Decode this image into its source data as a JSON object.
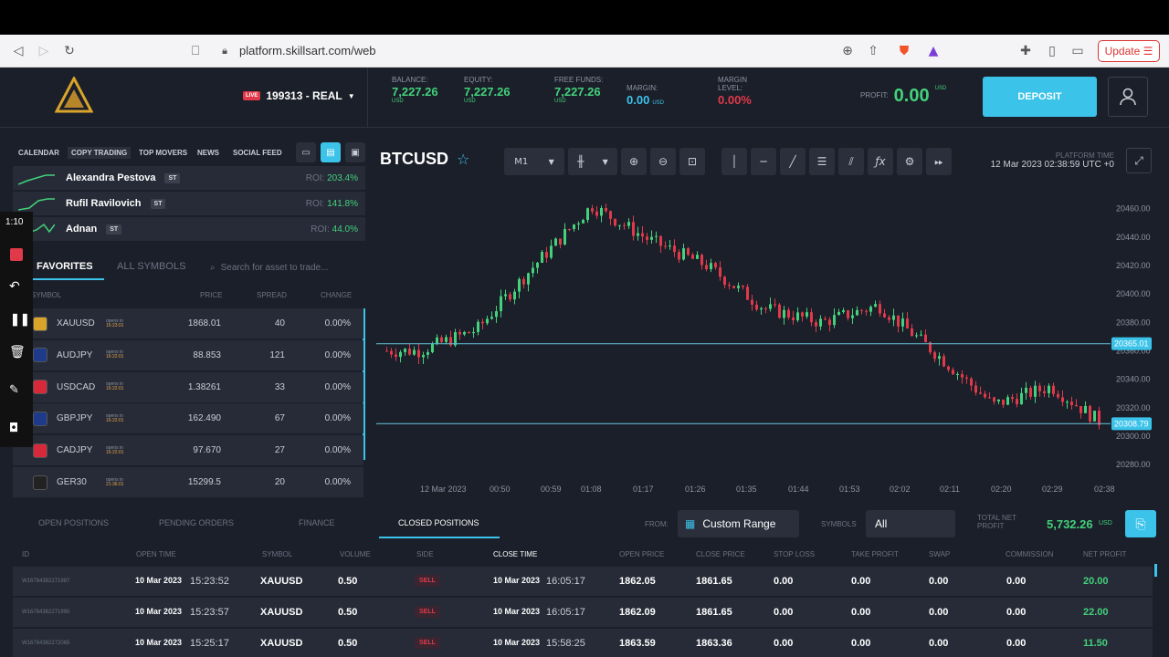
{
  "browser": {
    "url": "platform.skillsart.com/web",
    "update_label": "Update"
  },
  "header": {
    "account": "199313 - REAL",
    "live": "LIVE",
    "balance": {
      "label": "BALANCE:",
      "value": "7,227.26",
      "unit": "USD"
    },
    "equity": {
      "label": "EQUITY:",
      "value": "7,227.26",
      "unit": "USD"
    },
    "free_funds": {
      "label": "FREE FUNDS:",
      "value": "7,227.26",
      "unit": "USD"
    },
    "margin": {
      "label": "MARGIN:",
      "value": "0.00",
      "unit": "USD"
    },
    "margin_level": {
      "label1": "MARGIN",
      "label2": "LEVEL:",
      "value": "0.00%"
    },
    "profit": {
      "label": "PROFIT:",
      "value": "0.00",
      "unit": "USD"
    },
    "deposit_label": "DEPOSIT"
  },
  "left": {
    "tabs": [
      "CALENDAR",
      "COPY TRADING",
      "TOP MOVERS",
      "NEWS",
      "SOCIAL FEED"
    ],
    "traders": [
      {
        "name": "Alexandra Pestova",
        "badge": "ST",
        "roi_label": "ROI:",
        "roi": "203.4%"
      },
      {
        "name": "Rufil Ravilovich",
        "badge": "ST",
        "roi_label": "ROI:",
        "roi": "141.8%"
      },
      {
        "name": "Adnan",
        "badge": "ST",
        "roi_label": "ROI:",
        "roi": "44.0%"
      }
    ],
    "timestamp": "1:10",
    "symbol_tabs": [
      "FAVORITES",
      "ALL SYMBOLS"
    ],
    "search_placeholder": "Search for asset to trade...",
    "headers": [
      "SYMBOL",
      "PRICE",
      "SPREAD",
      "CHANGE"
    ],
    "symbols": [
      {
        "name": "XAUUSD",
        "opens": "opens in",
        "time": "16:23:01",
        "price": "1868.01",
        "spread": "40",
        "change": "0.00%",
        "color": "#d9a42a"
      },
      {
        "name": "AUDJPY",
        "opens": "opens in",
        "time": "16:22:01",
        "price": "88.853",
        "spread": "121",
        "change": "0.00%",
        "color": "#1e3a8a"
      },
      {
        "name": "USDCAD",
        "opens": "opens in",
        "time": "16:22:01",
        "price": "1.38261",
        "spread": "33",
        "change": "0.00%",
        "color": "#d8293a"
      },
      {
        "name": "GBPJPY",
        "opens": "opens in",
        "time": "16:22:01",
        "price": "162.490",
        "spread": "67",
        "change": "0.00%",
        "color": "#1e3a8a"
      },
      {
        "name": "CADJPY",
        "opens": "opens in",
        "time": "16:22:01",
        "price": "97.670",
        "spread": "27",
        "change": "0.00%",
        "color": "#d8293a"
      },
      {
        "name": "GER30",
        "opens": "opens in",
        "time": "21:36:01",
        "price": "15299.5",
        "spread": "20",
        "change": "0.00%",
        "color": "#222"
      }
    ]
  },
  "chart": {
    "symbol": "BTCUSD",
    "timeframe": "M1",
    "platform_time_label": "PLATFORM TIME",
    "platform_time": "12 Mar 2023  02:38:59 UTC +0",
    "price_labels": [
      "20460.00",
      "20440.00",
      "20420.00",
      "20400.00",
      "20380.00",
      "20360.00",
      "20340.00",
      "20320.00",
      "20300.00",
      "20280.00"
    ],
    "hline_labels": [
      "20365.01",
      "20308.79"
    ],
    "time_labels": [
      "12 Mar 2023",
      "00:50",
      "00:59",
      "01:08",
      "01:17",
      "01:26",
      "01:35",
      "01:44",
      "01:53",
      "02:02",
      "02:11",
      "02:20",
      "02:29",
      "02:38"
    ]
  },
  "chart_data": {
    "type": "candlestick",
    "symbol": "BTCUSD",
    "ylim": [
      20275,
      20470
    ],
    "x": [
      "00:50",
      "00:59",
      "01:08",
      "01:17",
      "01:26",
      "01:35",
      "01:44",
      "01:53",
      "02:02",
      "02:11",
      "02:20",
      "02:29",
      "02:38"
    ],
    "close": [
      20360,
      20375,
      20420,
      20462,
      20438,
      20420,
      20390,
      20380,
      20392,
      20358,
      20322,
      20335,
      20306
    ],
    "horizontal_lines": [
      20365.01,
      20308.79
    ]
  },
  "bottom": {
    "tabs": [
      "OPEN POSITIONS",
      "PENDING ORDERS",
      "FINANCE",
      "CLOSED POSITIONS"
    ],
    "from_label": "FROM:",
    "range": "Custom Range",
    "symbols_label": "SYMBOLS",
    "symbols_value": "All",
    "total_label1": "TOTAL NET",
    "total_label2": "PROFIT",
    "total_value": "5,732.26",
    "total_unit": "USD",
    "headers": [
      "ID",
      "OPEN TIME",
      "SYMBOL",
      "VOLUME",
      "SIDE",
      "CLOSE TIME",
      "OPEN PRICE",
      "CLOSE PRICE",
      "STOP LOSS",
      "TAKE PROFIT",
      "SWAP",
      "COMMISSION",
      "NET PROFIT"
    ],
    "rows": [
      {
        "id": "W16784382271987",
        "open_date": "10 Mar 2023",
        "open_time": "15:23:52",
        "symbol": "XAUUSD",
        "volume": "0.50",
        "side": "SELL",
        "close_date": "10 Mar 2023",
        "close_time": "16:05:17",
        "open_price": "1862.05",
        "close_price": "1861.65",
        "sl": "0.00",
        "tp": "0.00",
        "swap": "0.00",
        "comm": "0.00",
        "net": "20.00"
      },
      {
        "id": "W16784382271990",
        "open_date": "10 Mar 2023",
        "open_time": "15:23:57",
        "symbol": "XAUUSD",
        "volume": "0.50",
        "side": "SELL",
        "close_date": "10 Mar 2023",
        "close_time": "16:05:17",
        "open_price": "1862.09",
        "close_price": "1861.65",
        "sl": "0.00",
        "tp": "0.00",
        "swap": "0.00",
        "comm": "0.00",
        "net": "22.00"
      },
      {
        "id": "W16784382272065",
        "open_date": "10 Mar 2023",
        "open_time": "15:25:17",
        "symbol": "XAUUSD",
        "volume": "0.50",
        "side": "SELL",
        "close_date": "10 Mar 2023",
        "close_time": "15:58:25",
        "open_price": "1863.59",
        "close_price": "1863.36",
        "sl": "0.00",
        "tp": "0.00",
        "swap": "0.00",
        "comm": "0.00",
        "net": "11.50"
      }
    ]
  }
}
